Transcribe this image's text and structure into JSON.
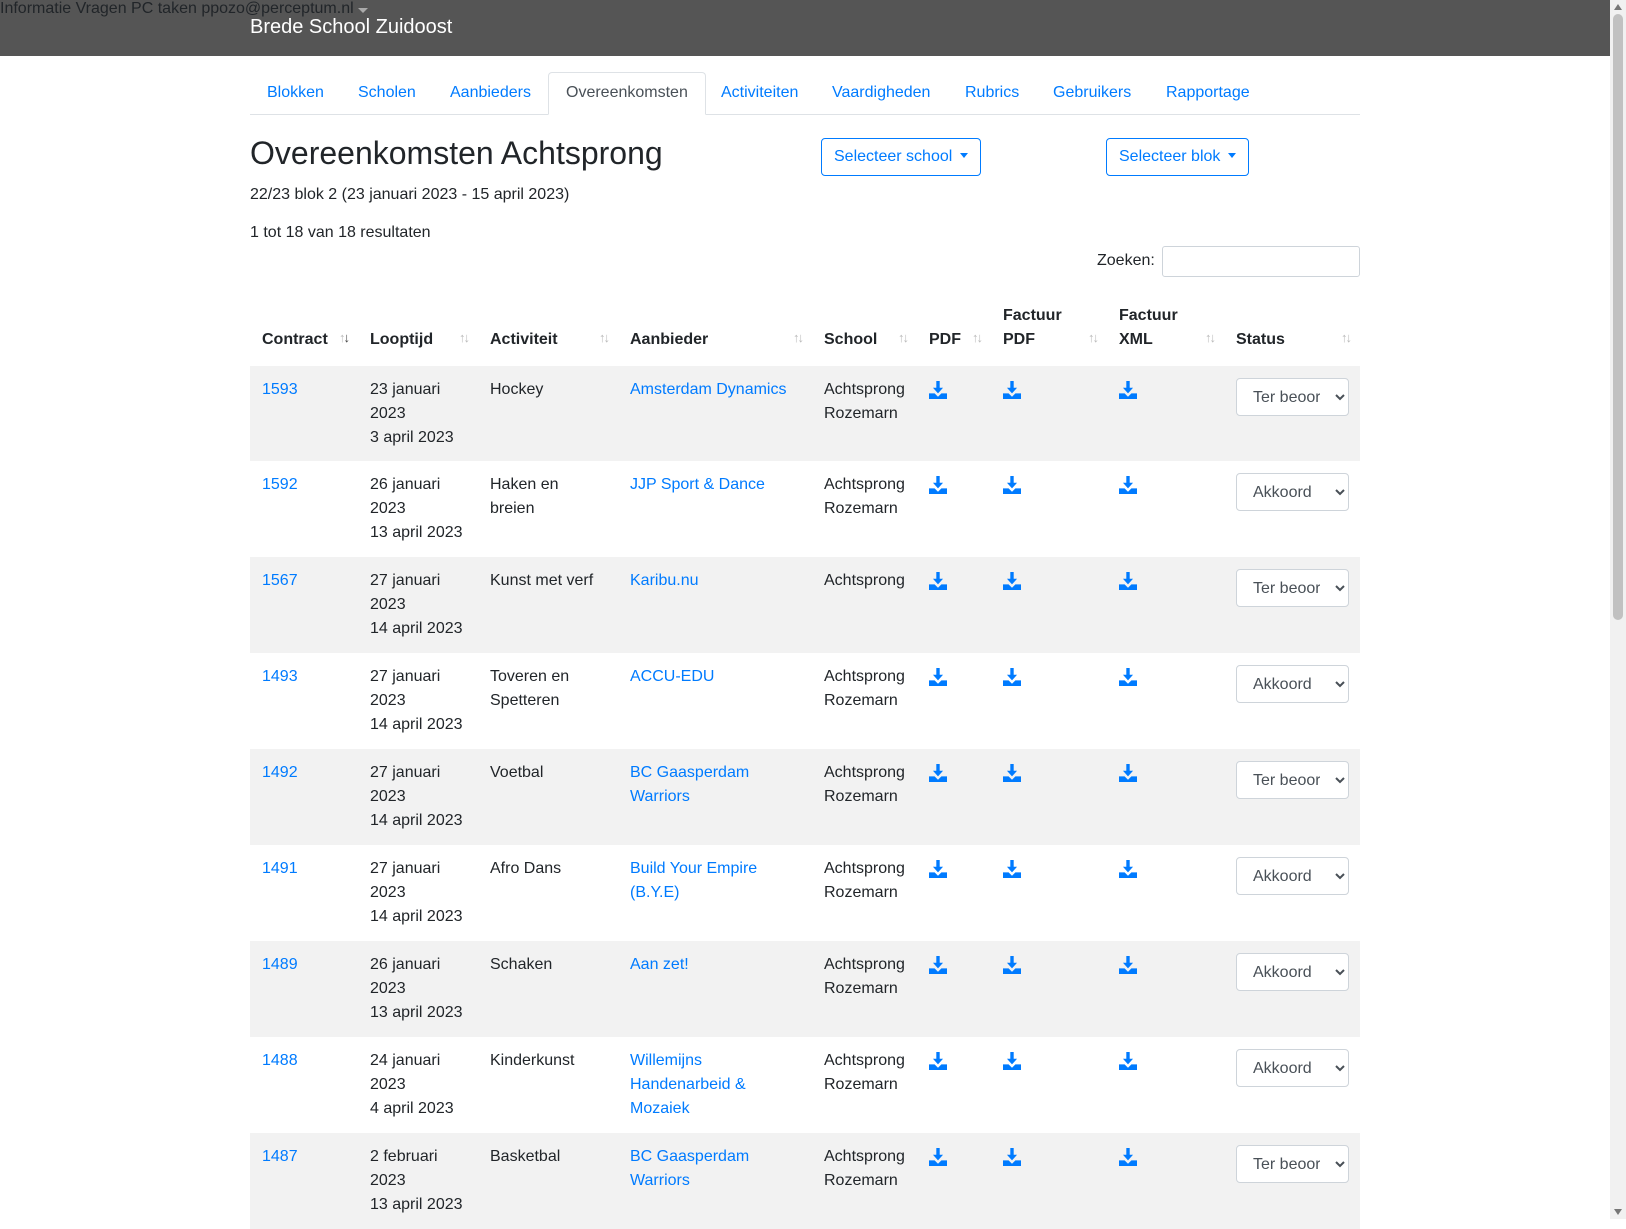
{
  "navbar": {
    "brand": "Brede School Zuidoost",
    "links": [
      "Informatie",
      "Vragen",
      "PC taken",
      "ppozo@perceptum.nl"
    ]
  },
  "tabs": [
    "Blokken",
    "Scholen",
    "Aanbieders",
    "Overeenkomsten",
    "Activiteiten",
    "Vaardigheden",
    "Rubrics",
    "Gebruikers",
    "Rapportage"
  ],
  "active_tab": "Overeenkomsten",
  "page": {
    "title": "Overeenkomsten Achtsprong",
    "period": "22/23 blok 2 (23 januari 2023 - 15 april 2023)",
    "results": "1 tot 18 van 18 resultaten",
    "select_school": "Selecteer school",
    "select_block": "Selecteer blok",
    "search_label": "Zoeken:",
    "search_value": ""
  },
  "table": {
    "headers": {
      "contract": "Contract",
      "looptijd": "Looptijd",
      "activiteit": "Activiteit",
      "aanbieder": "Aanbieder",
      "school": "School",
      "pdf": "PDF",
      "factuur_pdf_1": "Factuur",
      "factuur_pdf_2": "PDF",
      "factuur_xml_1": "Factuur",
      "factuur_xml_2": "XML",
      "status": "Status"
    },
    "rows": [
      {
        "contract": "1593",
        "start": "23 januari 2023",
        "end": "3 april 2023",
        "activiteit": "Hockey",
        "aanbieder": "Amsterdam Dynamics",
        "school": "Achtsprong Rozemarn",
        "status": "Ter beoordeling"
      },
      {
        "contract": "1592",
        "start": "26 januari 2023",
        "end": "13 april 2023",
        "activiteit": "Haken en breien",
        "aanbieder": "JJP Sport & Dance",
        "school": "Achtsprong Rozemarn",
        "status": "Akkoord"
      },
      {
        "contract": "1567",
        "start": "27 januari 2023",
        "end": "14 april 2023",
        "activiteit": "Kunst met verf",
        "aanbieder": "Karibu.nu",
        "school": "Achtsprong",
        "status": "Ter beoordeling"
      },
      {
        "contract": "1493",
        "start": "27 januari 2023",
        "end": "14 april 2023",
        "activiteit": "Toveren en Spetteren",
        "aanbieder": "ACCU-EDU",
        "school": "Achtsprong Rozemarn",
        "status": "Akkoord"
      },
      {
        "contract": "1492",
        "start": "27 januari 2023",
        "end": "14 april 2023",
        "activiteit": "Voetbal",
        "aanbieder": "BC Gaasperdam Warriors",
        "school": "Achtsprong Rozemarn",
        "status": "Ter beoordeling"
      },
      {
        "contract": "1491",
        "start": "27 januari 2023",
        "end": "14 april 2023",
        "activiteit": "Afro Dans",
        "aanbieder": "Build Your Empire (B.Y.E)",
        "school": "Achtsprong Rozemarn",
        "status": "Akkoord"
      },
      {
        "contract": "1489",
        "start": "26 januari 2023",
        "end": "13 april 2023",
        "activiteit": "Schaken",
        "aanbieder": "Aan zet!",
        "school": "Achtsprong Rozemarn",
        "status": "Akkoord"
      },
      {
        "contract": "1488",
        "start": "24 januari 2023",
        "end": "4 april 2023",
        "activiteit": "Kinderkunst",
        "aanbieder": "Willemijns Handenarbeid & Mozaiek",
        "school": "Achtsprong Rozemarn",
        "status": "Akkoord"
      },
      {
        "contract": "1487",
        "start": "2 februari 2023",
        "end": "13 april 2023",
        "activiteit": "Basketbal",
        "aanbieder": "BC Gaasperdam Warriors",
        "school": "Achtsprong Rozemarn",
        "status": "Ter beoordeling"
      }
    ],
    "status_options": [
      "Ter beoordeling",
      "Akkoord"
    ]
  },
  "colors": {
    "navbar": "#555555",
    "link": "#007bff",
    "stripe": "#f2f2f2"
  },
  "icons": {
    "download": "download-icon",
    "sort": "sort-icon",
    "select_caret": "caret-icon"
  }
}
